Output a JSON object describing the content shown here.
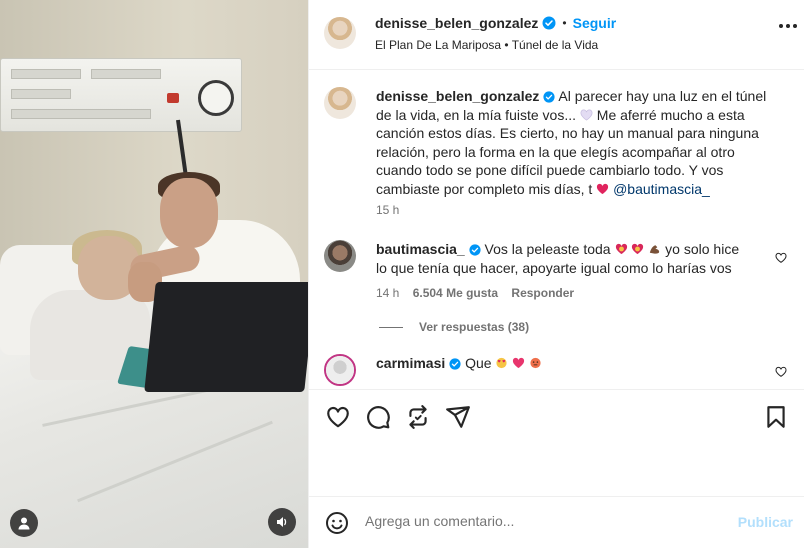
{
  "header": {
    "username": "denisse_belen_gonzalez",
    "separator": "•",
    "follow_label": "Seguir",
    "audio": "El Plan De La Mariposa • Túnel de la Vida"
  },
  "caption": {
    "username": "denisse_belen_gonzalez",
    "text_a": "Al parecer hay una luz en el túnel de la vida, en la mía fuiste vos...",
    "text_b": "Me aferré mucho a esta canción estos días. Es cierto, no hay un manual para ninguna relación, pero la forma en la que elegís acompañar al otro cuando todo se pone difícil puede cambiarlo todo. Y vos cambiaste por completo mis días, t",
    "mention": "@bautimascia_",
    "time": "15 h"
  },
  "comments": [
    {
      "username": "bautimascia_",
      "text_a": "Vos la peleaste toda",
      "text_b": "yo solo hice lo que tenía que hacer, apoyarte igual como lo harías vos",
      "time": "14 h",
      "likes": "6.504 Me gusta",
      "reply_label": "Responder",
      "view_replies": "Ver respuestas (38)"
    },
    {
      "username": "carmimasi",
      "text": "Que"
    }
  ],
  "composer": {
    "placeholder": "Agrega un comentario...",
    "publish_label": "Publicar"
  },
  "colors": {
    "accent": "#0095f6",
    "verified": "#0095f6",
    "heart": "#ed4956",
    "muted": "#737373"
  },
  "icons": [
    "heart-icon",
    "comment-icon",
    "repost-icon",
    "share-icon",
    "bookmark-icon",
    "smile-icon",
    "more-icon",
    "user-tag-icon",
    "sound-icon"
  ]
}
